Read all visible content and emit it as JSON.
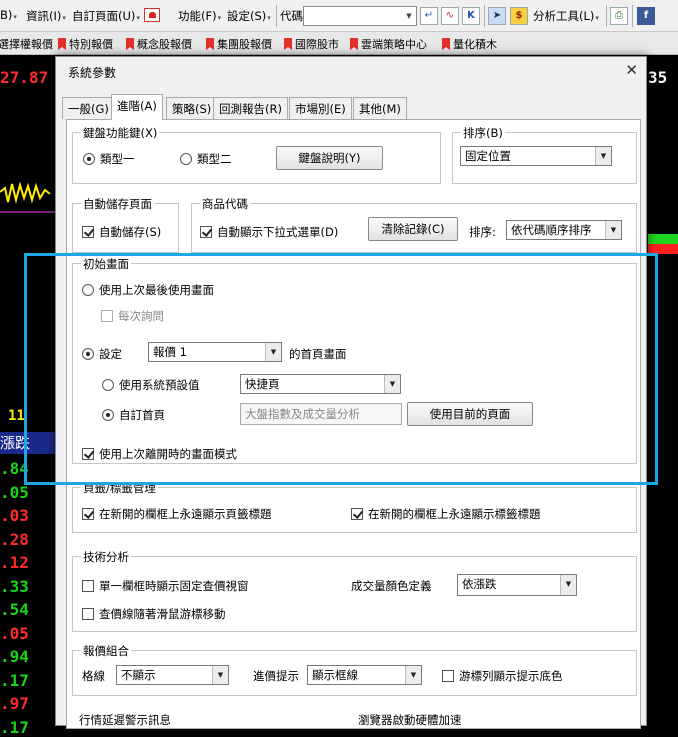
{
  "menubar": {
    "items": [
      {
        "label": "B)",
        "arrow": "▾"
      },
      {
        "label": "資訊(I)",
        "arrow": "▾"
      },
      {
        "label": "自訂頁面(U)",
        "arrow": "▾"
      },
      {
        "label": "功能(F)",
        "arrow": "▾"
      },
      {
        "label": "設定(S)",
        "arrow": "▾"
      }
    ],
    "code_label": "代碼",
    "code_value": "",
    "analysis_label": "分析工具(L)",
    "analysis_arrow": "▾",
    "icons": [
      "enter-icon",
      "chart-icon",
      "k-line-icon",
      "cursor-icon",
      "dollar-icon",
      "print-icon",
      "facebook-icon"
    ]
  },
  "bookmarks": [
    "選擇權報價",
    "特別報價",
    "概念股報價",
    "集團股報價",
    "國際股市",
    "雲端策略中心",
    "量化積木"
  ],
  "background": {
    "top_left_value": "27.87",
    "top_right_value": "35",
    "left_label": "11",
    "column_header": "漲跌",
    "values": [
      ".84",
      ".05",
      ".03",
      ".28",
      ".12",
      ".33",
      ".54",
      ".05",
      ".94",
      ".17",
      ".97",
      ".17"
    ]
  },
  "dialog": {
    "title": "系統參數",
    "close": "✕",
    "tabs": [
      "一般(G)",
      "進階(A)",
      "策略(S)",
      "回測報告(R)",
      "市場別(E)",
      "其他(M)"
    ],
    "active_tab": "進階(A)",
    "hotkey": {
      "title": "鍵盤功能鍵(X)",
      "option1": "類型一",
      "option2": "類型二",
      "explain_button": "鍵盤說明(Y)"
    },
    "sort": {
      "title": "排序(B)",
      "value": "固定位置"
    },
    "autosave": {
      "title": "自動儲存頁面",
      "checkbox": "自動儲存(S)"
    },
    "product_code": {
      "title": "商品代碼",
      "checkbox": "自動顯示下拉式選單(D)",
      "clear_button": "清除記錄(C)",
      "sort_label": "排序:",
      "sort_value": "依代碼順序排序"
    },
    "initial_screen": {
      "title": "初始畫面",
      "use_last": "使用上次最後使用畫面",
      "ask_each": "每次詢問",
      "set_label": "設定",
      "set_value": "報價 1",
      "homepage_suffix": "的首頁畫面",
      "use_default": "使用系統預設值",
      "default_value": "快捷頁",
      "custom_home": "自訂首頁",
      "custom_value": "大盤指數及成交量分析",
      "use_current_button": "使用目前的頁面",
      "use_last_mode": "使用上次離開時的畫面模式"
    },
    "tab_mgmt": {
      "title": "頁籤/標籤管理",
      "cb1": "在新開的欄框上永遠顯示頁籤標題",
      "cb2": "在新開的欄框上永遠顯示標籤標題"
    },
    "tech": {
      "title": "技術分析",
      "cb1": "單一欄框時顯示固定查價視窗",
      "cb2": "查價線隨著滑鼠游標移動",
      "volume_label": "成交量顏色定義",
      "volume_value": "依漲跌"
    },
    "quote": {
      "title": "報價組合",
      "grid_label": "格線",
      "grid_value": "不顯示",
      "hint_label": "進價提示",
      "hint_value": "顯示框線",
      "cb": "游標列顯示提示底色"
    },
    "bottom_left": "行情延遲警示訊息",
    "bottom_right": "瀏覽器啟動硬體加速"
  }
}
